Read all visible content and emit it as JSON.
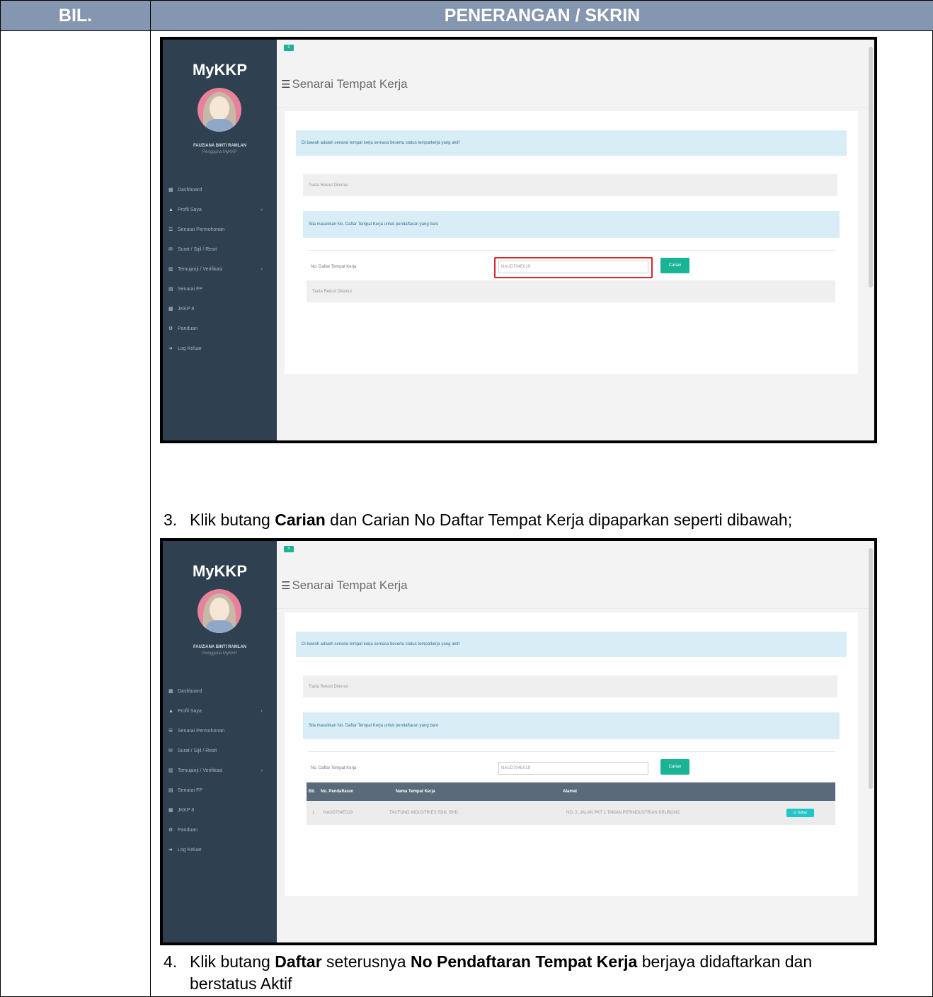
{
  "header": {
    "col_bil": "BIL.",
    "col_penerangan": "PENERANGAN / SKRIN"
  },
  "app": {
    "brand": "MyKKP",
    "user_name": "FAUZIANA BINTI RAMLAN",
    "user_role": "Pengguna MyKKP",
    "toggle_label": "≡",
    "page_title": "Senarai Tempat Kerja",
    "menu": [
      {
        "icon": "▦",
        "label": "Dashboard"
      },
      {
        "icon": "▲",
        "label": "Profil Saya",
        "caret": "‹"
      },
      {
        "icon": "☰",
        "label": "Senarai Permohonan"
      },
      {
        "icon": "✉",
        "label": "Surat / Sijil / Resit"
      },
      {
        "icon": "▥",
        "label": "Temujanji / Verifikasi",
        "caret": "‹"
      },
      {
        "icon": "▤",
        "label": "Senarai FP"
      },
      {
        "icon": "▦",
        "label": "JKKP 8"
      },
      {
        "icon": "⚙",
        "label": "Panduan"
      },
      {
        "icon": "➜",
        "label": "Log Keluar"
      }
    ],
    "info_text": "Di bawah adalah senarai tempat kerja semasa beserta status tempatkerja yang aktif",
    "empty_text": "Tiada Rekod Ditemui",
    "prompt_text": "Sila masukkan No. Daftar Tempat Kerja untuk pendaftaran yang baru",
    "form_label": "No. Daftar Tempat Kerja",
    "form_value": "NAUD704E019",
    "search_button": "Carian",
    "result_empty": "Tiada Rekod Ditemui",
    "table": {
      "headers": [
        "Bil.",
        "No. Pendaftaran",
        "Nama Tempat Kerja",
        "Alamat"
      ],
      "rows": [
        {
          "bil": "1",
          "no": "NAUD704E019",
          "nama": "TAUFUNG INDUSTRIES SDN. BHD.",
          "alamat": "NO. 3, JALAN PKT 1 TAMAN PERINDUSTRIAN KRUBONG",
          "action": "☑ Daftar"
        }
      ]
    }
  },
  "steps": {
    "step3": {
      "num": "3.",
      "pre": "Klik butang ",
      "bold1": "Carian",
      "post": " dan Carian No Daftar Tempat Kerja dipaparkan seperti dibawah;"
    },
    "step4": {
      "num": "4.",
      "pre": "Klik butang ",
      "bold1": "Daftar",
      "mid": " seterusnya ",
      "bold2": "No Pendaftaran Tempat Kerja",
      "post": " berjaya didaftarkan dan",
      "line2": "berstatus Aktif"
    }
  }
}
